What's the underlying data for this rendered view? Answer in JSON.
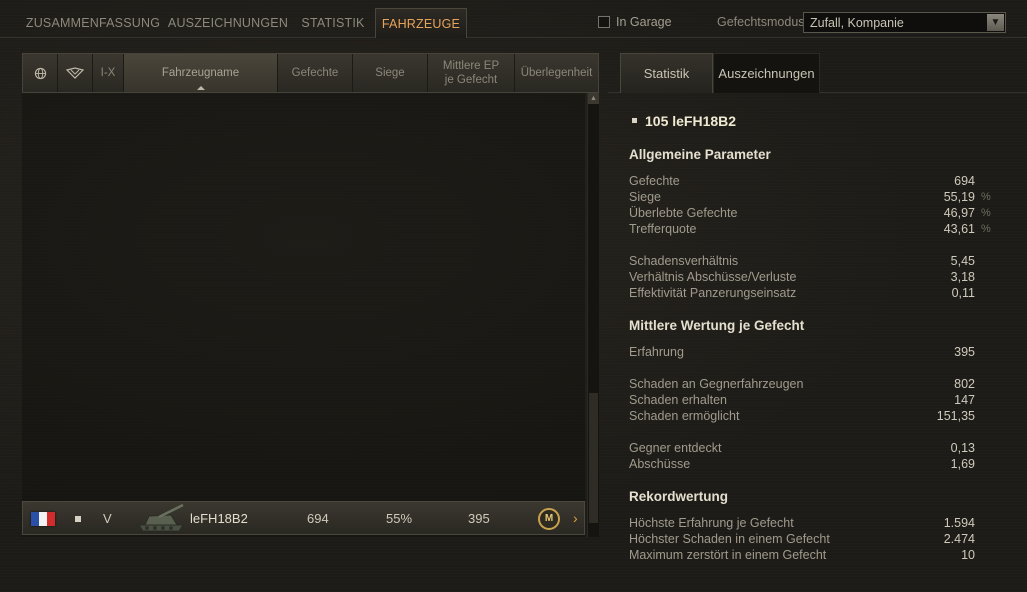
{
  "top_tabs": [
    {
      "label": "ZUSAMMENFASSUNG"
    },
    {
      "label": "AUSZEICHNUNGEN"
    },
    {
      "label": "STATISTIK"
    },
    {
      "label": "FAHRZEUGE"
    }
  ],
  "active_tab": "FAHRZEUGE",
  "filters": {
    "in_garage_label": "In Garage",
    "in_garage_checked": false,
    "mode_label": "Gefechtsmodus:",
    "mode_value": "Zufall, Kompanie"
  },
  "table": {
    "headers": {
      "nation_icon": "globe-icon",
      "type_icon": "tank-type-icon",
      "tier": "I-X",
      "name": "Fahrzeugname",
      "battles": "Gefechte",
      "wins": "Siege",
      "avg_xp_line1": "Mittlere EP",
      "avg_xp_line2": "je Gefecht",
      "mastery": "Überlegenheit"
    },
    "rows": [
      {
        "nation": "france",
        "tier": "V",
        "name": "leFH18B2",
        "battles": "694",
        "wins": "55%",
        "avg_xp": "395",
        "mastery_badge": "M"
      }
    ]
  },
  "detail": {
    "tabs": [
      "Statistik",
      "Auszeichnungen"
    ],
    "vehicle_title": "105 leFH18B2",
    "sections": [
      {
        "title": "Allgemeine Parameter",
        "stats": [
          {
            "label": "Gefechte",
            "value": "694",
            "unit": ""
          },
          {
            "label": "Siege",
            "value": "55,19",
            "unit": "%"
          },
          {
            "label": "Überlebte Gefechte",
            "value": "46,97",
            "unit": "%"
          },
          {
            "label": "Trefferquote",
            "value": "43,61",
            "unit": "%"
          },
          {
            "label": "Schadensverhältnis",
            "value": "5,45",
            "unit": ""
          },
          {
            "label": "Verhältnis Abschüsse/Verluste",
            "value": "3,18",
            "unit": ""
          },
          {
            "label": "Effektivität Panzerungseinsatz",
            "value": "0,11",
            "unit": ""
          }
        ]
      },
      {
        "title": "Mittlere Wertung je Gefecht",
        "stats": [
          {
            "label": "Erfahrung",
            "value": "395",
            "unit": ""
          },
          {
            "label": "Schaden an Gegnerfahrzeugen",
            "value": "802",
            "unit": ""
          },
          {
            "label": "Schaden erhalten",
            "value": "147",
            "unit": ""
          },
          {
            "label": "Schaden ermöglicht",
            "value": "151,35",
            "unit": ""
          },
          {
            "label": "Gegner entdeckt",
            "value": "0,13",
            "unit": ""
          },
          {
            "label": "Abschüsse",
            "value": "1,69",
            "unit": ""
          }
        ]
      },
      {
        "title": "Rekordwertung",
        "stats": [
          {
            "label": "Höchste Erfahrung je Gefecht",
            "value": "1.594",
            "unit": ""
          },
          {
            "label": "Höchster Schaden in einem Gefecht",
            "value": "2.474",
            "unit": ""
          },
          {
            "label": "Maximum zerstört in einem Gefecht",
            "value": "10",
            "unit": ""
          }
        ]
      }
    ]
  },
  "colors": {
    "accent_orange": "#e8a35a",
    "title_cream": "#f0ead3",
    "background": "#1d1b17"
  }
}
